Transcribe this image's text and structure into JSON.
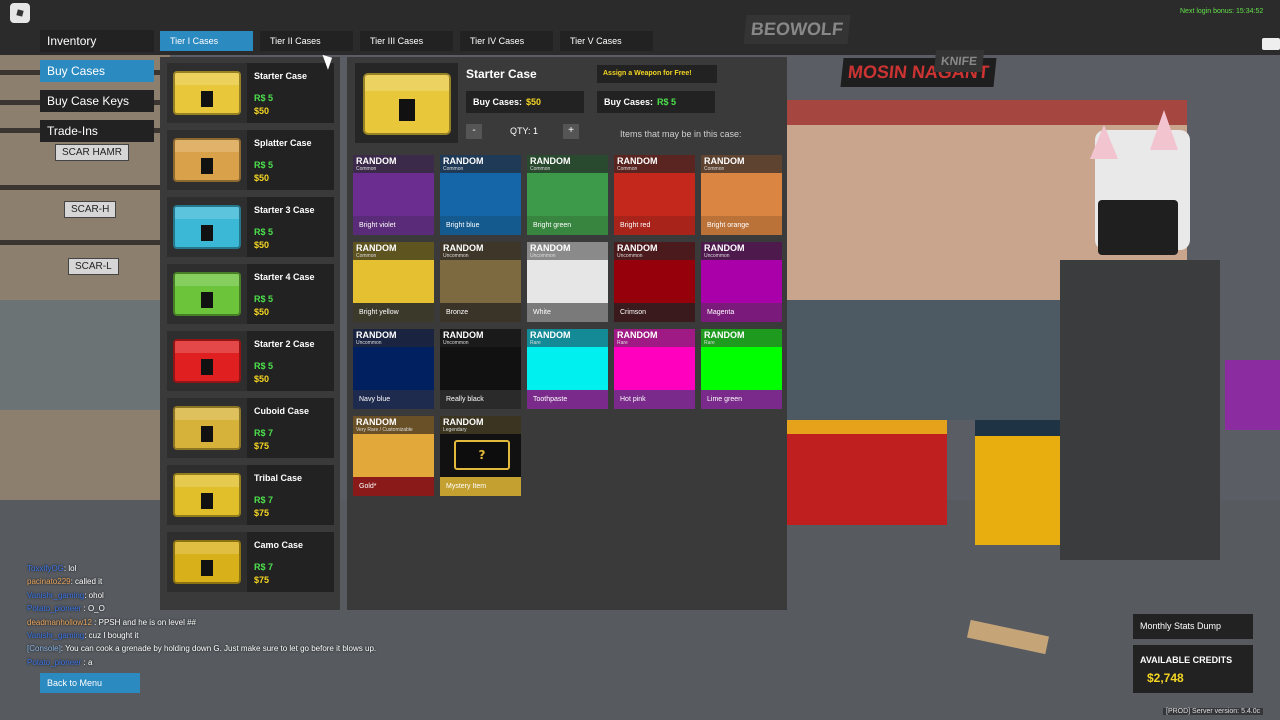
{
  "topbar": {
    "login_bonus": "Next login bonus: 15:34:52"
  },
  "nav": {
    "items": [
      {
        "label": "Inventory",
        "active": false
      },
      {
        "label": "Buy Cases",
        "active": true
      },
      {
        "label": "Buy Case Keys",
        "active": false
      },
      {
        "label": "Trade-Ins",
        "active": false
      }
    ]
  },
  "tiers": [
    {
      "label": "Tier I Cases",
      "active": true
    },
    {
      "label": "Tier II Cases",
      "active": false
    },
    {
      "label": "Tier III Cases",
      "active": false
    },
    {
      "label": "Tier IV Cases",
      "active": false
    },
    {
      "label": "Tier V Cases",
      "active": false
    }
  ],
  "scene": {
    "wall_labels": [
      "SCAR HAMR",
      "SCAR-H",
      "SCAR-L"
    ],
    "posters": [
      "BEOWOLF",
      "MOSIN NAGANT",
      "KNIFE"
    ]
  },
  "cases": [
    {
      "name": "Starter Case",
      "rs": "R$ 5",
      "usd": "$50",
      "color": "#e8c73a"
    },
    {
      "name": "Splatter Case",
      "rs": "R$ 5",
      "usd": "$50",
      "color": "#d9a24a"
    },
    {
      "name": "Starter 3 Case",
      "rs": "R$ 5",
      "usd": "$50",
      "color": "#3ab8d6"
    },
    {
      "name": "Starter 4 Case",
      "rs": "R$ 5",
      "usd": "$50",
      "color": "#6cc43a"
    },
    {
      "name": "Starter 2 Case",
      "rs": "R$ 5",
      "usd": "$50",
      "color": "#e02020"
    },
    {
      "name": "Cuboid Case",
      "rs": "R$ 7",
      "usd": "$75",
      "color": "#d7b23a"
    },
    {
      "name": "Tribal Case",
      "rs": "R$ 7",
      "usd": "$75",
      "color": "#e1bf2a"
    },
    {
      "name": "Camo Case",
      "rs": "R$ 7",
      "usd": "$75",
      "color": "#d8b019"
    }
  ],
  "detail": {
    "title": "Starter Case",
    "assign_label": "Assign a Weapon for Free!",
    "buy_label": "Buy Cases:",
    "buy_usd": "$50",
    "buy_rs": "R$ 5",
    "qty_minus": "-",
    "qty_plus": "+",
    "qty_label": "QTY: 1",
    "items_label": "Items that may be in this case:",
    "random_label": "RANDOM",
    "items": [
      {
        "rarity": "Common",
        "name": "Bright violet",
        "swatch": "#6b2d8f",
        "hdr": "#3c2a4a",
        "ftr": "#5a2b78"
      },
      {
        "rarity": "Common",
        "name": "Bright blue",
        "swatch": "#1466a8",
        "hdr": "#1e3a57",
        "ftr": "#155a8f"
      },
      {
        "rarity": "Common",
        "name": "Bright green",
        "swatch": "#3e9a4b",
        "hdr": "#2a4a2f",
        "ftr": "#37853f"
      },
      {
        "rarity": "Common",
        "name": "Bright red",
        "swatch": "#c4281c",
        "hdr": "#5a2420",
        "ftr": "#a8231a"
      },
      {
        "rarity": "Common",
        "name": "Bright orange",
        "swatch": "#da8541",
        "hdr": "#5e4330",
        "ftr": "#bb7238"
      },
      {
        "rarity": "Common",
        "name": "Bright yellow",
        "swatch": "#e5c132",
        "hdr": "#5e5420",
        "ftr": "#3b3a2a"
      },
      {
        "rarity": "Uncommon",
        "name": "Bronze",
        "swatch": "#7e6a40",
        "hdr": "#3e3628",
        "ftr": "#3a3328"
      },
      {
        "rarity": "Uncommon",
        "name": "White",
        "swatch": "#e6e6e6",
        "hdr": "#8a8a8a",
        "ftr": "#7a7a7a"
      },
      {
        "rarity": "Uncommon",
        "name": "Crimson",
        "swatch": "#96000a",
        "hdr": "#4a1a1c",
        "ftr": "#3a1a1c"
      },
      {
        "rarity": "Uncommon",
        "name": "Magenta",
        "swatch": "#aa00aa",
        "hdr": "#4e1a4e",
        "ftr": "#7a1a7a"
      },
      {
        "rarity": "Uncommon",
        "name": "Navy blue",
        "swatch": "#002060",
        "hdr": "#1a2440",
        "ftr": "#1e2a4e"
      },
      {
        "rarity": "Uncommon",
        "name": "Really black",
        "swatch": "#111111",
        "hdr": "#1a1a1a",
        "ftr": "#2a2a2a"
      },
      {
        "rarity": "Rare",
        "name": "Toothpaste",
        "swatch": "#00f0f0",
        "hdr": "#148a96",
        "ftr": "#7a2a8a"
      },
      {
        "rarity": "Rare",
        "name": "Hot pink",
        "swatch": "#ff00bf",
        "hdr": "#a01a86",
        "ftr": "#7a2a8a"
      },
      {
        "rarity": "Rare",
        "name": "Lime green",
        "swatch": "#00ff00",
        "hdr": "#1e9a1e",
        "ftr": "#7a2a8a"
      },
      {
        "rarity": "Very Rare / Customizable",
        "name": "Gold*",
        "swatch": "#e2a83a",
        "hdr": "#6a5026",
        "ftr": "#8a1a1a"
      },
      {
        "rarity": "Legendary",
        "name": "Mystery Item",
        "swatch": "#111111",
        "hdr": "#3a3420",
        "ftr": "#c4a030",
        "mystery": "?"
      }
    ]
  },
  "chat": [
    {
      "user": "ToxxifyOG",
      "sep": ": ",
      "msg": "lol",
      "kind": "blue"
    },
    {
      "user": "pacinato229",
      "sep": ": ",
      "msg": "called it",
      "kind": "red"
    },
    {
      "user": "Vanishr_gaming",
      "sep": ": ",
      "msg": "ohol",
      "kind": "blue"
    },
    {
      "user": "Potato_pioneer",
      "sep": " : ",
      "msg": "O_O",
      "kind": "blue"
    },
    {
      "user": "deadmanhollow12",
      "sep": " : ",
      "msg": "PPSH and he is on level ##",
      "kind": "red"
    },
    {
      "user": "Vanishr_gaming",
      "sep": ": ",
      "msg": "cuz I bought it",
      "kind": "blue"
    },
    {
      "user": "[Console]",
      "sep": ": ",
      "msg": "You can cook a grenade by holding down G. Just make sure to let go before it blows up.",
      "kind": "console"
    },
    {
      "user": "Potato_pioneer",
      "sep": " : ",
      "msg": "a",
      "kind": "blue"
    }
  ],
  "footer": {
    "back_label": "Back to Menu",
    "stats_label": "Monthly Stats Dump",
    "credits_label": "AVAILABLE CREDITS",
    "credits_value": "$2,748",
    "server_version": "[PROD] Server version: 5.4.0c"
  }
}
